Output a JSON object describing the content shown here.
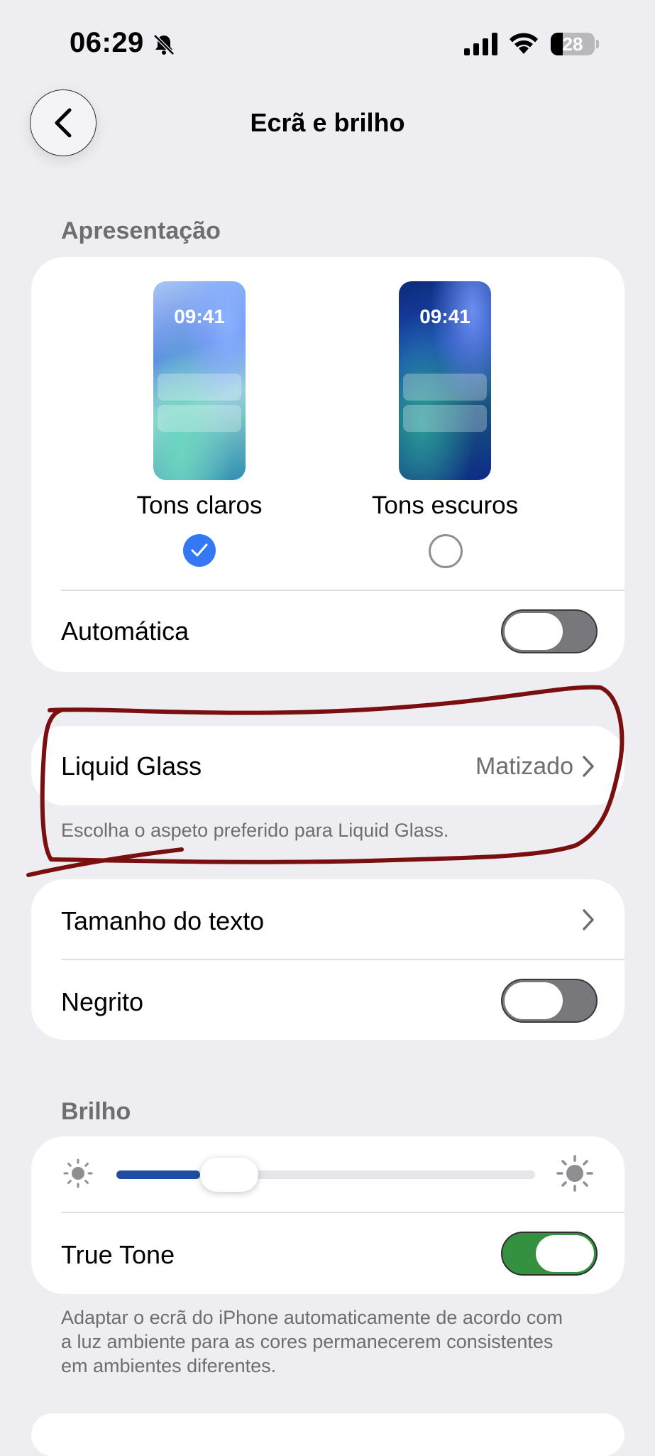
{
  "status_bar": {
    "time": "06:29",
    "battery_level": "28",
    "icons": [
      "bell-slash-icon",
      "signal-icon",
      "wifi-icon",
      "battery-icon"
    ]
  },
  "nav": {
    "title": "Ecrã e brilho",
    "back_icon": "chevron-left-icon"
  },
  "appearance": {
    "header": "Apresentação",
    "preview_time": "09:41",
    "options": [
      {
        "label": "Tons claros",
        "selected": true
      },
      {
        "label": "Tons escuros",
        "selected": false
      }
    ],
    "automatic": {
      "label": "Automática",
      "on": false
    }
  },
  "liquid_glass": {
    "label": "Liquid Glass",
    "value": "Matizado",
    "footnote": "Escolha o aspeto preferido para Liquid Glass."
  },
  "text_settings": {
    "text_size_label": "Tamanho do texto",
    "bold_label": "Negrito",
    "bold_on": false
  },
  "brightness": {
    "header": "Brilho",
    "level": 0.2,
    "true_tone_label": "True Tone",
    "true_tone_on": true,
    "footnote": "Adaptar o ecrã do iPhone automaticamente de acordo com a luz ambiente para as cores permanecerem consistentes em ambientes diferentes."
  },
  "colors": {
    "accent": "#3478f6",
    "toggle_on": "#34913f",
    "slider_fill": "#1f4ea0",
    "annotation": "#7a0f0f"
  }
}
